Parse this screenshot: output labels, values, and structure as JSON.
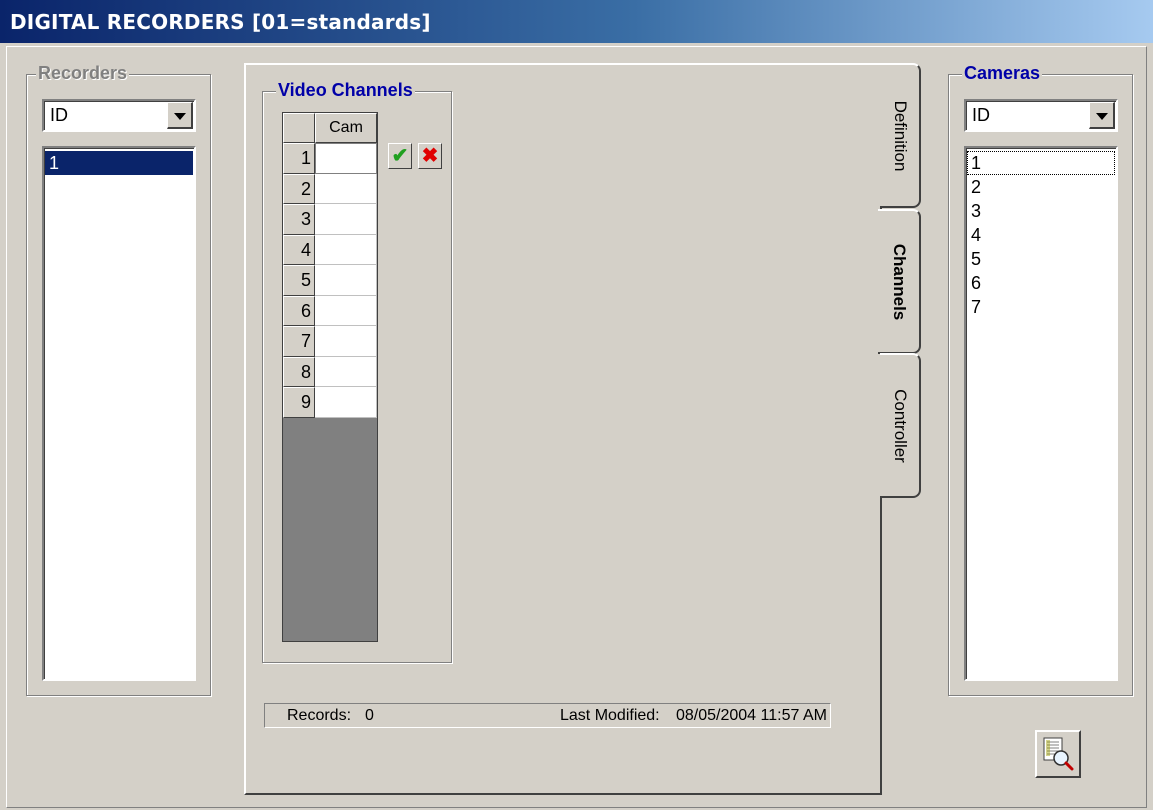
{
  "window": {
    "title": "DIGITAL RECORDERS  [01=standards]"
  },
  "recorders": {
    "label": "Recorders",
    "sort_value": "ID",
    "items": [
      "1"
    ],
    "selected_index": 0
  },
  "video_channels": {
    "label": "Video Channels",
    "column_header": "Cam",
    "rows": [
      "1",
      "2",
      "3",
      "4",
      "5",
      "6",
      "7",
      "8",
      "9"
    ],
    "values": [
      "",
      "",
      "",
      "",
      "",
      "",
      "",
      "",
      ""
    ]
  },
  "tabs": [
    {
      "label": "Definition",
      "active": false
    },
    {
      "label": "Channels",
      "active": true
    },
    {
      "label": "Controller",
      "active": false
    }
  ],
  "status": {
    "records_label": "Records:",
    "records_value": "0",
    "modified_label": "Last Modified:",
    "modified_value": "08/05/2004 11:57 AM"
  },
  "cameras": {
    "label": "Cameras",
    "sort_value": "ID",
    "items": [
      "1",
      "2",
      "3",
      "4",
      "5",
      "6",
      "7"
    ],
    "focused_index": 0
  },
  "icons": {
    "combo_arrow": "chevron-down-icon",
    "confirm": "checkmark-icon",
    "cancel": "close-icon",
    "report_preview": "report-preview-icon"
  },
  "colors": {
    "title_gradient_start": "#0a246a",
    "title_gradient_end": "#a6caf0",
    "selection": "#0a246a",
    "legend_blue": "#0000a8",
    "confirm_green": "#20a020",
    "cancel_red": "#e00000"
  }
}
